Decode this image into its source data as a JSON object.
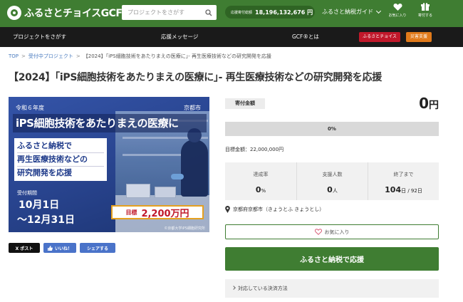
{
  "header": {
    "logo_text": "ふるさとチョイスGCF",
    "search_placeholder": "プロジェクトをさがす",
    "total_label": "応援寄付総額",
    "total_value": "18,196,132,676 円",
    "guide_label": "ふるさと納税ガイド",
    "favorites_label": "お気に入り",
    "donated_label": "寄付する"
  },
  "nav": {
    "items": [
      "プロジェクトをさがす",
      "応援メッセージ",
      "GCF®とは"
    ],
    "badge_choice": "ふるさとチョイス",
    "badge_disaster": "災害支援"
  },
  "breadcrumb": {
    "top": "TOP",
    "accepting": "受付中プロジェクト",
    "current": "【2024】｢iPS細胞技術をあたりまえの医療に｣- 再生医療技術などの研究開発を応援"
  },
  "title": "【2024】｢iPS細胞技術をあたりまえの医療に｣- 再生医療技術などの研究開発を応援",
  "hero": {
    "year": "令和６年度",
    "city": "京都市",
    "headline": "iPS細胞技術をあたりまえの医療に",
    "box_lines": [
      "ふるさと納税で",
      "再生医療技術などの",
      "研究開発を応援"
    ],
    "period_label": "受付期間",
    "date_start": "10月1日",
    "date_end": "〜12月31日",
    "goal_label": "目標",
    "goal_value": "2,200万円",
    "credit": "©京都大学iPS細胞研究所"
  },
  "share": {
    "x_post": "X ポスト",
    "like": "いいね！",
    "share": "シェアする"
  },
  "donation": {
    "tag": "寄付金額",
    "amount": "0",
    "amount_unit": "円",
    "progress_text": "0%",
    "progress_fraction": 0,
    "target": "目標金額：22,000,000円"
  },
  "stats": [
    {
      "label": "達成率",
      "value": "0",
      "unit": "%"
    },
    {
      "label": "支援人数",
      "value": "0",
      "unit": "人"
    },
    {
      "label": "終了まで",
      "value": "104",
      "unit": "日 / 92日"
    }
  ],
  "location": "京都府京都市（きょうとふ きょうとし）",
  "favorite_button": "お気に入り",
  "donate_button": "ふるさと納税で応援",
  "payment_methods": "対応している決済方法",
  "colors": {
    "brand_green": "#3f7d32",
    "nav_dark": "#1a1a1a",
    "badge_red": "#c0182a",
    "badge_orange": "#e07a1a"
  }
}
